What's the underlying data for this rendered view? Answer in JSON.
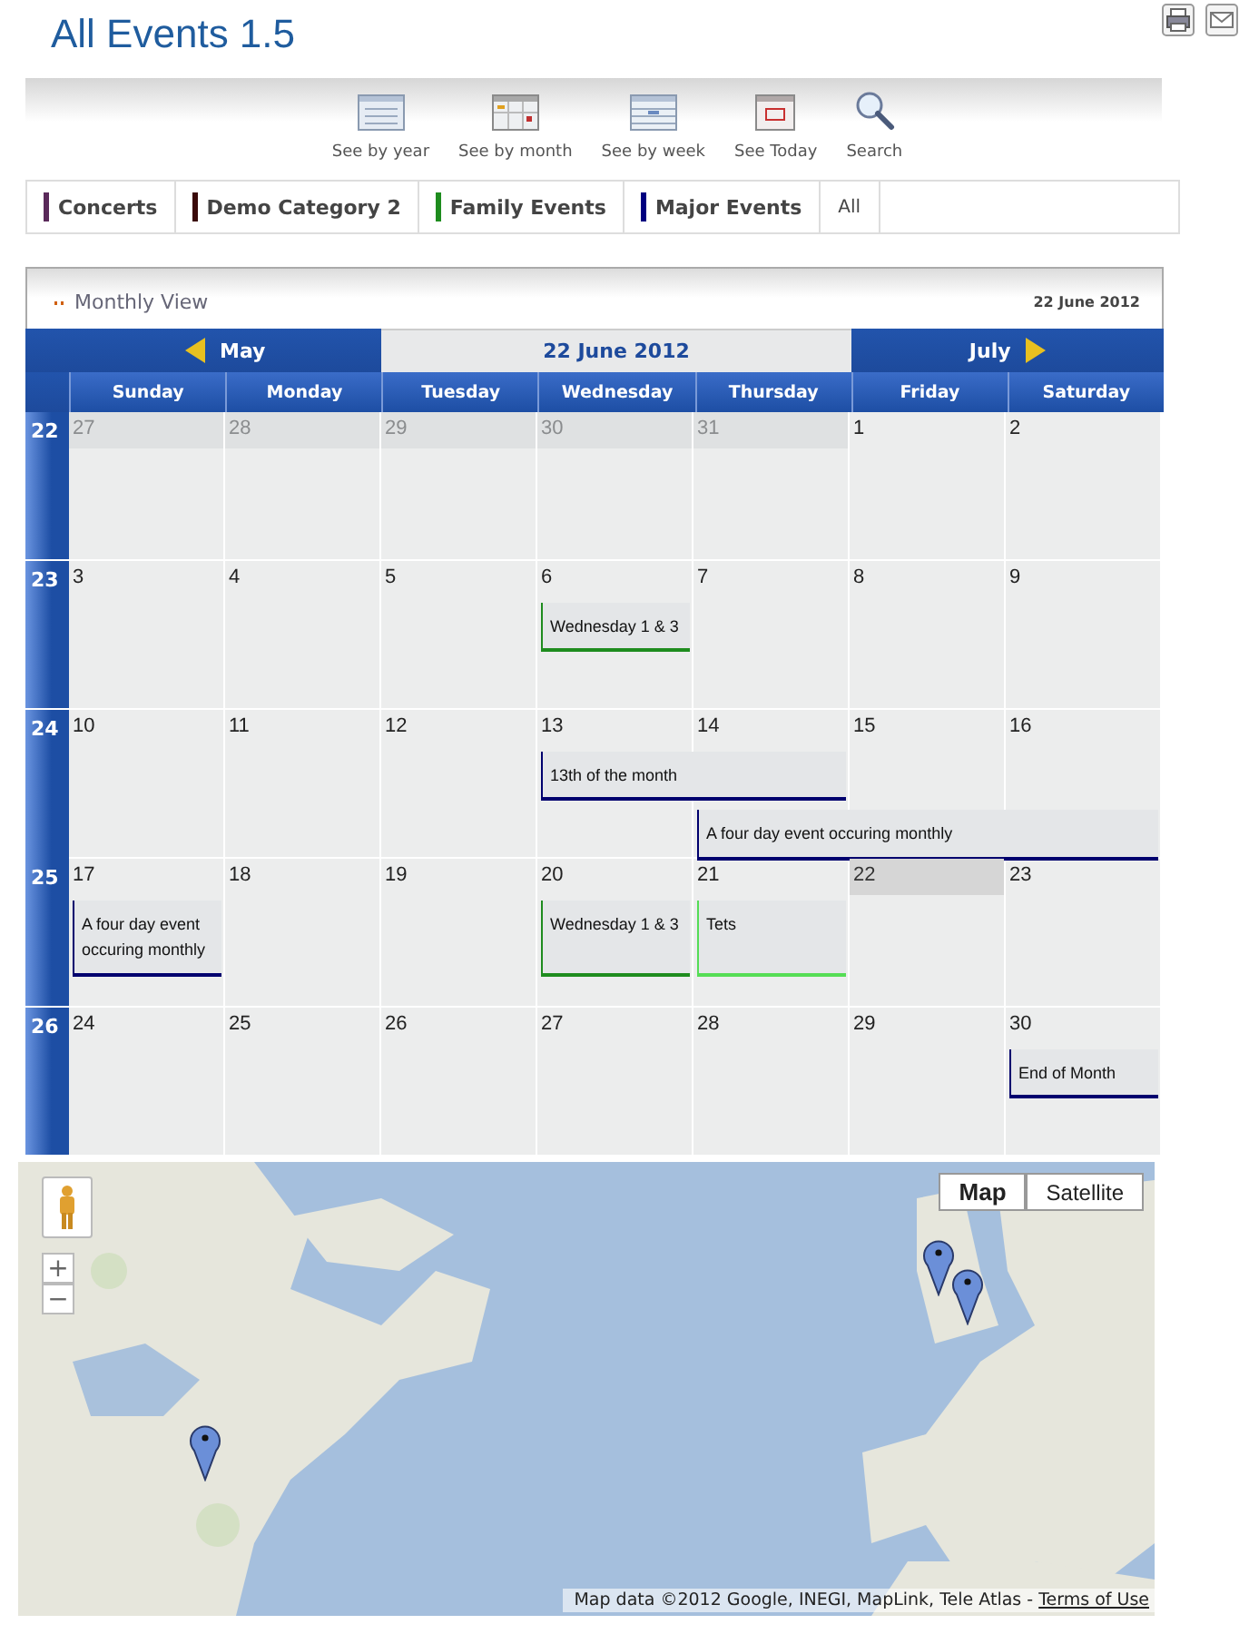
{
  "page": {
    "title": "All Events 1.5"
  },
  "toolbar": [
    {
      "kind": "year",
      "label": "See by year"
    },
    {
      "kind": "month",
      "label": "See by month"
    },
    {
      "kind": "week",
      "label": "See by week"
    },
    {
      "kind": "today",
      "label": "See Today"
    },
    {
      "kind": "search",
      "label": "Search"
    }
  ],
  "categories": [
    {
      "label": "Concerts",
      "color": "#5a2a5a"
    },
    {
      "label": "Demo Category 2",
      "color": "#3a0a0a"
    },
    {
      "label": "Family Events",
      "color": "#1e8c1e"
    },
    {
      "label": "Major Events",
      "color": "#000080"
    },
    {
      "label": "All"
    }
  ],
  "calendar": {
    "view_title": "Monthly View",
    "date": "22 June 2012",
    "prev_month": "May",
    "current": "22 June 2012",
    "next_month": "July",
    "weekdays": [
      "Sunday",
      "Monday",
      "Tuesday",
      "Wednesday",
      "Thursday",
      "Friday",
      "Saturday"
    ],
    "weeks": [
      {
        "number": "22",
        "days": [
          {
            "day": "27",
            "other_month": true,
            "today": false
          },
          {
            "day": "28",
            "other_month": true,
            "today": false
          },
          {
            "day": "29",
            "other_month": true,
            "today": false
          },
          {
            "day": "30",
            "other_month": true,
            "today": false
          },
          {
            "day": "31",
            "other_month": true,
            "today": false
          },
          {
            "day": "1",
            "other_month": false,
            "today": false
          },
          {
            "day": "2",
            "other_month": false,
            "today": false
          }
        ]
      },
      {
        "number": "23",
        "days": [
          {
            "day": "3",
            "other_month": false,
            "today": false
          },
          {
            "day": "4",
            "other_month": false,
            "today": false
          },
          {
            "day": "5",
            "other_month": false,
            "today": false
          },
          {
            "day": "6",
            "other_month": false,
            "today": false,
            "events": [
              {
                "title": "Wednesday 1 & 3",
                "color": "#1e8c1e",
                "kind": "one_day"
              }
            ]
          },
          {
            "day": "7",
            "other_month": false,
            "today": false
          },
          {
            "day": "8",
            "other_month": false,
            "today": false
          },
          {
            "day": "9",
            "other_month": false,
            "today": false
          }
        ]
      },
      {
        "number": "24",
        "days": [
          {
            "day": "10",
            "other_month": false,
            "today": false
          },
          {
            "day": "11",
            "other_month": false,
            "today": false
          },
          {
            "day": "12",
            "other_month": false,
            "today": false
          },
          {
            "day": "13",
            "other_month": false,
            "today": false,
            "events": [
              {
                "title": "13th of the month",
                "color": "#00006e",
                "kind": "two_day"
              }
            ]
          },
          {
            "day": "14",
            "other_month": false,
            "today": false,
            "events": [
              {
                "title": "A four day event occuring monthly",
                "color": "#00006e",
                "kind": "three_day"
              }
            ]
          },
          {
            "day": "15",
            "other_month": false,
            "today": false
          },
          {
            "day": "16",
            "other_month": false,
            "today": false
          }
        ]
      },
      {
        "number": "25",
        "days": [
          {
            "day": "17",
            "other_month": false,
            "today": false,
            "events": [
              {
                "title": "A four day event occuring monthly",
                "color": "#00006e",
                "kind": "one_day"
              }
            ]
          },
          {
            "day": "18",
            "other_month": false,
            "today": false
          },
          {
            "day": "19",
            "other_month": false,
            "today": false
          },
          {
            "day": "20",
            "other_month": false,
            "today": false,
            "events": [
              {
                "title": "Wednesday 1 & 3",
                "color": "#1e8c1e",
                "kind": "one_day"
              }
            ]
          },
          {
            "day": "21",
            "other_month": false,
            "today": false,
            "events": [
              {
                "title": "Tets",
                "color": "#55dd55",
                "kind": "one_day"
              }
            ]
          },
          {
            "day": "22",
            "other_month": false,
            "today": true
          },
          {
            "day": "23",
            "other_month": false,
            "today": false
          }
        ]
      },
      {
        "number": "26",
        "days": [
          {
            "day": "24",
            "other_month": false,
            "today": false
          },
          {
            "day": "25",
            "other_month": false,
            "today": false
          },
          {
            "day": "26",
            "other_month": false,
            "today": false
          },
          {
            "day": "27",
            "other_month": false,
            "today": false
          },
          {
            "day": "28",
            "other_month": false,
            "today": false
          },
          {
            "day": "29",
            "other_month": false,
            "today": false
          },
          {
            "day": "30",
            "other_month": false,
            "today": false,
            "events": [
              {
                "title": "End of Month",
                "color": "#00006e",
                "kind": "one_day"
              }
            ]
          }
        ]
      }
    ]
  },
  "map": {
    "kind": "picture",
    "zoom_in": "+",
    "zoom_out": "−",
    "map_types": [
      {
        "label": "Map",
        "selected": true
      },
      {
        "label": "Satellite",
        "selected": false
      }
    ],
    "attribution": "Map data ©2012 Google, INEGI, MapLink, Tele Atlas - ",
    "terms_link": "Terms of Use"
  }
}
